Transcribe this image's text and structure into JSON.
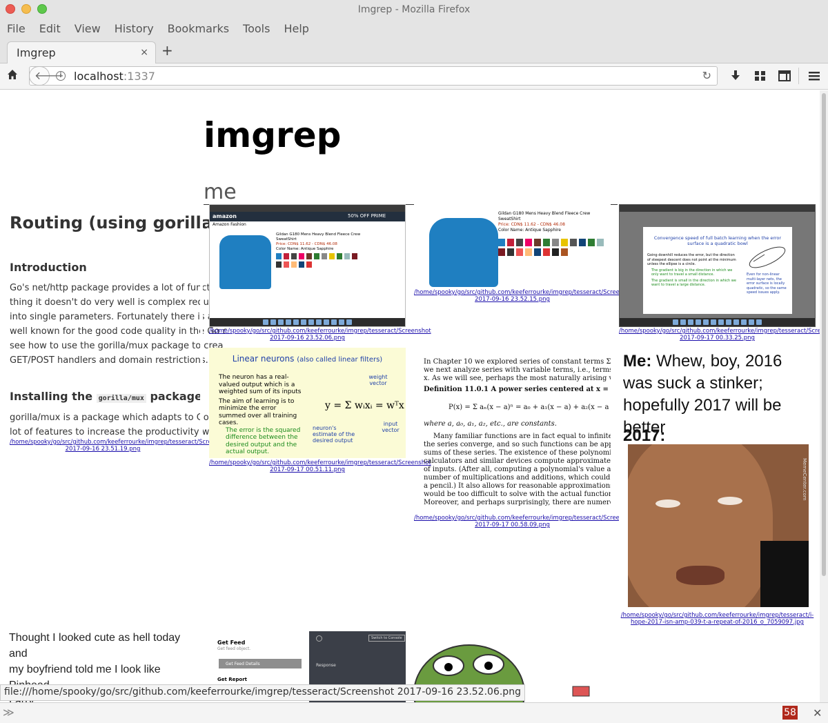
{
  "window": {
    "title": "Imgrep - Mozilla Firefox"
  },
  "menu": [
    "File",
    "Edit",
    "View",
    "History",
    "Bookmarks",
    "Tools",
    "Help"
  ],
  "tab": {
    "label": "Imgrep",
    "close": "×",
    "new": "+"
  },
  "nav": {
    "url_host": "localhost",
    "url_port": ":1337"
  },
  "page": {
    "title": "imgrep",
    "query": "me"
  },
  "results": [
    {
      "caption": "/home/spooky/go/src/github.com/keeferrourke/imgrep/tesseract/Screenshot 2017-09-16 23.52.06.png"
    },
    {
      "caption": "/home/spooky/go/src/github.com/keeferrourke/imgrep/tesseract/Screenshot 2017-09-16 23.52.15.png"
    },
    {
      "caption": "/home/spooky/go/src/github.com/keeferrourke/imgrep/tesseract/Screenshot 2017-09-17 00.33.25.png"
    },
    {
      "caption": "/home/spooky/go/src/github.com/keeferrourke/imgrep/tesseract/Screenshot 2017-09-16 23.51.19.png"
    },
    {
      "caption": "/home/spooky/go/src/github.com/keeferrourke/imgrep/tesseract/Screenshot 2017-09-17 00.51.11.png"
    },
    {
      "caption": "/home/spooky/go/src/github.com/keeferrourke/imgrep/tesseract/Screenshot 2017-09-17 00.58.09.png"
    },
    {
      "caption": "/home/spooky/go/src/github.com/keeferrourke/imgrep/tesseract/i-hope-2017-isn-amp-039-t-a-repeat-of-2016_o_7059097.jpg"
    }
  ],
  "article": {
    "heading": "Routing (using gorilla/m",
    "intro_heading": "Introduction",
    "intro_lines": [
      "Go's net/http package provides a lot of functior",
      "thing it doesn't do very well is complex request r",
      "into single parameters. Fortunately there is a very",
      "well known for the good code quality in the Go c",
      "see how to use the gorilla/mux package to crea",
      "GET/POST handlers and domain restrictions."
    ],
    "install_heading_pre": "Installing the",
    "install_heading_code": "gorilla/mux",
    "install_heading_post": "package",
    "install_lines": [
      "gorilla/mux is a package which adapts to Go's",
      "lot of features to increase the productivity when v"
    ]
  },
  "amazon": {
    "product": "Gildan G180 Mens Heavy Blend Fleece Crew SweatShirt",
    "price": "Price: CDN$ 11.62 - CDN$ 46.08",
    "color": "Color Name: Antique Sapphire",
    "store": "Amazon Fashion",
    "badge": "50% OFF PRIME"
  },
  "slide1": {
    "title": "Convergence speed of full batch learning when the error surface is a quadratic bowl",
    "bullet": "Going downhill reduces the error, but the direction of steepest descent does not point at the minimum unless the ellipse is a circle.",
    "g1": "The gradient is big in the direction in which we only want to travel a small distance.",
    "g2": "The gradient is small in the direction in which we want to travel a large distance.",
    "side": "Even for non-linear multi-layer nets, the error surface is locally quadratic, so the same speed issues apply."
  },
  "slide2": {
    "title": "Linear neurons",
    "title_small": "(also called linear filters)",
    "b1": "The neuron has a real-valued output which is a weighted sum of its inputs",
    "b2": "The aim of learning is to minimize the error summed over all training cases.",
    "g": "The error is the squared difference between the desired output and the actual output.",
    "weight": "weight vector",
    "neuron": "neuron's estimate of the desired output",
    "input": "input vector",
    "formula": "y = Σ wᵢxᵢ = wᵀx"
  },
  "math": {
    "l1": "In Chapter 10 we explored series of constant terms Σ aₙ",
    "l2": "we next analyze series with variable terms, i.e., terms which",
    "l3": "x. As we will see, perhaps the most naturally arising variab",
    "def": "Definition 11.0.1  A power series centered at x = a is",
    "formula": "P(x) = Σ aₙ(x − a)ⁿ = a₀ + a₁(x − a) + a₂(x − a",
    "where": "where a, a₀, a₁, a₂, etc., are constants.",
    "p": [
      "Many familiar functions are in fact equal to infinite serie",
      "the series converge, and so such functions can be approximat",
      "sums of these series. The existence of these polynomial part",
      "calculators and similar devices compute approximate values",
      "of inputs. (After all, computing a polynomial's value at a",
      "number of multiplications and additions, which could even b",
      "a pencil.) It also allows for reasonable approximations in app",
      "would be too difficult to solve with the actual functions, but r",
      "Moreover, and perhaps surprisingly, there are numerous se"
    ]
  },
  "meme": {
    "me_label": "Me:",
    "me_text": "Whew, boy, 2016 was suck a stinker; hopefully 2017 will be better",
    "year": "2017:",
    "watermark": "MemeCenter.com"
  },
  "bottom": {
    "tweet": [
      "Thought I looked cute as hell today and",
      "my boyfriend told me I look like Pinhead",
      "Larry"
    ],
    "feed_title": "Get Feed",
    "feed_sub": "Get feed object.",
    "feed_btn": "Get Feed Details",
    "report": "Get Report",
    "console": "Switch to Console",
    "response": "Response"
  },
  "status_url": "file:///home/spooky/go/src/github.com/keeferrourke/imgrep/tesseract/Screenshot 2017-09-16 23.52.06.png",
  "findbar": {
    "count": "58"
  }
}
